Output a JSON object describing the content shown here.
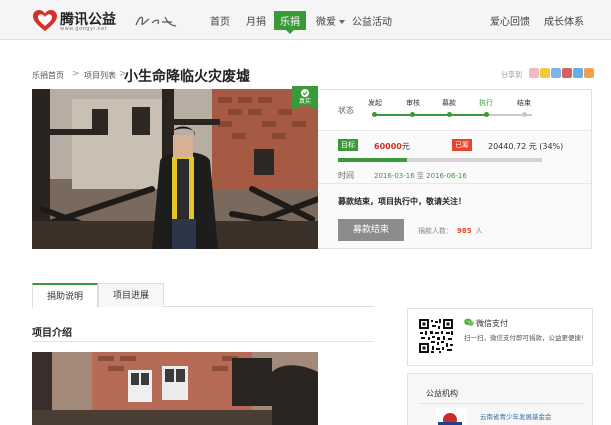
{
  "header": {
    "logo_text": "腾讯公益",
    "logo_url": "www.gongyi.net",
    "nav": [
      {
        "label": "首页"
      },
      {
        "label": "月捐"
      },
      {
        "label": "乐捐",
        "active": true
      },
      {
        "label": "微爱",
        "dropdown": true
      },
      {
        "label": "公益活动"
      },
      {
        "label": "爱心回馈"
      },
      {
        "label": "成长体系"
      }
    ]
  },
  "breadcrumb": {
    "items": [
      "乐捐首页",
      "项目列表"
    ],
    "separator": ">"
  },
  "page_title": "小生命降临火灾废墟",
  "share_label": "分享到",
  "share_colors": [
    "#f2b8c8",
    "#f0c93c",
    "#7fb4e6",
    "#d96060",
    "#6aaee8",
    "#f5a04a"
  ],
  "project": {
    "tag_icon": "check-icon",
    "tag_label": "真实",
    "status_label": "状态",
    "steps": [
      {
        "label": "发起",
        "done": true
      },
      {
        "label": "审核",
        "done": true
      },
      {
        "label": "募款",
        "done": true
      },
      {
        "label": "执行",
        "done": true,
        "active": true
      },
      {
        "label": "结束",
        "done": false
      }
    ],
    "target_badge": "目标",
    "target_amount": "60000",
    "currency": "元",
    "raised_badge": "已筹",
    "raised_text": "20440.72 元 (34%)",
    "progress_percent": 34,
    "time_label": "时间",
    "date_start": "2016-03-16",
    "date_sep": "至",
    "date_end": "2016-06-16",
    "message": "募款结束，项目执行中，敬请关注！",
    "end_button": "募款结束",
    "donors_label": "捐款人数：",
    "donors_count": "985",
    "donors_unit": "人"
  },
  "tabs": [
    {
      "label": "捐助说明",
      "active": true
    },
    {
      "label": "项目进展",
      "active": false
    }
  ],
  "section_title": "项目介绍",
  "pay": {
    "title": "微信支付",
    "desc": "扫一扫，微信支付即可捐款，公益更便捷！"
  },
  "org": {
    "title": "公益机构",
    "name": "云南省青少年发展基金会"
  },
  "colors": {
    "brand_green": "#3a9a3a",
    "brand_red": "#d7302b",
    "raised_red": "#e6452b"
  }
}
